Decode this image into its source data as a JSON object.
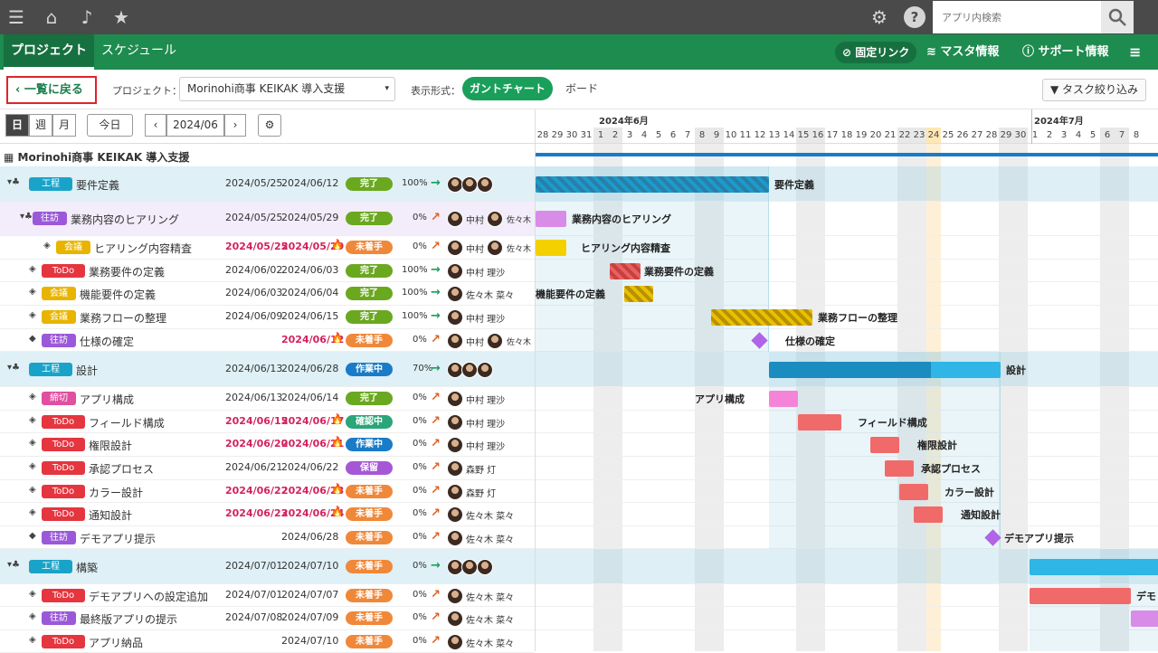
{
  "topbar": {
    "search_placeholder": "アプリ内検索",
    "icons": [
      "menu-icon",
      "home-icon",
      "bell-icon",
      "star-icon",
      "gear-icon",
      "help-icon",
      "search-icon"
    ]
  },
  "nav": {
    "tabs": [
      "プロジェクト",
      "スケジュール"
    ],
    "fixed_link": "固定リンク",
    "master": "マスタ情報",
    "support": "サポート情報"
  },
  "controls": {
    "back": "一覧に戻る",
    "project_label": "プロジェクト：",
    "project_value": "Morinohi商事 KEIKAK 導入支援",
    "view_label": "表示形式：",
    "view_gantt": "ガントチャート",
    "view_board": "ボード",
    "filter": "タスク絞り込み"
  },
  "toolbar": {
    "day": "日",
    "week": "週",
    "month": "月",
    "today": "今日",
    "current_month": "2024/06"
  },
  "project_title": "Morinohi商事 KEIKAK 導入支援",
  "timeline": {
    "months": [
      "2024年6月",
      "2024年7月"
    ],
    "days": [
      "28",
      "29",
      "30",
      "31",
      "1",
      "2",
      "3",
      "4",
      "5",
      "6",
      "7",
      "8",
      "9",
      "10",
      "11",
      "12",
      "13",
      "14",
      "15",
      "16",
      "17",
      "18",
      "19",
      "20",
      "21",
      "22",
      "23",
      "24",
      "25",
      "26",
      "27",
      "28",
      "29",
      "30",
      "1",
      "2",
      "3",
      "4",
      "5",
      "6",
      "7",
      "8"
    ]
  },
  "colors": {
    "green": "#1e8b4f",
    "done": "#6aa820",
    "notstarted": "#f0883a",
    "inprogress": "#1a7bc6",
    "checking": "#2aa67a",
    "hold": "#a657d6",
    "kotei": "#1aa3c8",
    "oufuku": "#9b59d9",
    "kaigi": "#e8b400",
    "todo": "#e5353f",
    "shime": "#e04fa0"
  },
  "rows": [
    {
      "type": "工程",
      "name": "要件定義",
      "start": "2024/05/25",
      "end": "2024/06/12",
      "status": "完了",
      "pct": "100",
      "people": "",
      "group": true
    },
    {
      "type": "往訪",
      "name": "業務内容のヒアリング",
      "start": "2024/05/25",
      "end": "2024/05/29",
      "status": "完了",
      "pct": "0",
      "people": "中村",
      "people2": "佐々木",
      "sub": true
    },
    {
      "type": "会議",
      "name": "ヒアリング内容精査",
      "start": "2024/05/25",
      "end": "2024/05/29",
      "status": "未着手",
      "pct": "0",
      "people": "中村",
      "people2": "佐々木",
      "late": true
    },
    {
      "type": "ToDo",
      "name": "業務要件の定義",
      "start": "2024/06/02",
      "end": "2024/06/03",
      "status": "完了",
      "pct": "100",
      "people": "中村 理沙"
    },
    {
      "type": "会議",
      "name": "機能要件の定義",
      "start": "2024/06/03",
      "end": "2024/06/04",
      "status": "完了",
      "pct": "100",
      "people": "佐々木 菜々"
    },
    {
      "type": "会議",
      "name": "業務フローの整理",
      "start": "2024/06/09",
      "end": "2024/06/15",
      "status": "完了",
      "pct": "100",
      "people": "中村 理沙"
    },
    {
      "type": "往訪",
      "name": "仕様の確定",
      "start": "",
      "end": "2024/06/12",
      "status": "未着手",
      "pct": "0",
      "people": "中村",
      "people2": "佐々木",
      "late": true,
      "milestone": true
    },
    {
      "type": "工程",
      "name": "設計",
      "start": "2024/06/13",
      "end": "2024/06/28",
      "status": "作業中",
      "pct": "70",
      "people": "",
      "group": true
    },
    {
      "type": "締切",
      "name": "アプリ構成",
      "start": "2024/06/13",
      "end": "2024/06/14",
      "status": "完了",
      "pct": "0",
      "people": "中村 理沙"
    },
    {
      "type": "ToDo",
      "name": "フィールド構成",
      "start": "2024/06/15",
      "end": "2024/06/17",
      "status": "確認中",
      "pct": "0",
      "people": "中村 理沙",
      "late": true
    },
    {
      "type": "ToDo",
      "name": "権限設計",
      "start": "2024/06/20",
      "end": "2024/06/21",
      "status": "作業中",
      "pct": "0",
      "people": "中村 理沙",
      "late": true
    },
    {
      "type": "ToDo",
      "name": "承認プロセス",
      "start": "2024/06/21",
      "end": "2024/06/22",
      "status": "保留",
      "pct": "0",
      "people": "森野 灯"
    },
    {
      "type": "ToDo",
      "name": "カラー設計",
      "start": "2024/06/22",
      "end": "2024/06/23",
      "status": "未着手",
      "pct": "0",
      "people": "森野 灯",
      "late": true
    },
    {
      "type": "ToDo",
      "name": "通知設計",
      "start": "2024/06/23",
      "end": "2024/06/24",
      "status": "未着手",
      "pct": "0",
      "people": "佐々木 菜々",
      "late": true
    },
    {
      "type": "往訪",
      "name": "デモアプリ提示",
      "start": "",
      "end": "2024/06/28",
      "status": "未着手",
      "pct": "0",
      "people": "佐々木 菜々",
      "milestone": true
    },
    {
      "type": "工程",
      "name": "構築",
      "start": "2024/07/01",
      "end": "2024/07/10",
      "status": "未着手",
      "pct": "0",
      "people": "",
      "group": true
    },
    {
      "type": "ToDo",
      "name": "デモアプリへの設定追加",
      "start": "2024/07/01",
      "end": "2024/07/07",
      "status": "未着手",
      "pct": "0",
      "people": "佐々木 菜々"
    },
    {
      "type": "往訪",
      "name": "最終版アプリの提示",
      "start": "2024/07/08",
      "end": "2024/07/09",
      "status": "未着手",
      "pct": "0",
      "people": "佐々木 菜々"
    },
    {
      "type": "ToDo",
      "name": "アプリ納品",
      "start": "",
      "end": "2024/07/10",
      "status": "未着手",
      "pct": "0",
      "people": "佐々木 菜々"
    }
  ],
  "chart_labels": [
    "要件定義",
    "業務内容のヒアリング",
    "ヒアリング内容精査",
    "業務要件の定義",
    "機能要件の定義",
    "業務フローの整理",
    "仕様の確定",
    "設計",
    "アプリ構成",
    "フィールド構成",
    "権限設計",
    "承認プロセス",
    "カラー設計",
    "通知設計",
    "デモアプリ提示",
    "",
    "デモ",
    ""
  ],
  "pct_suffix": "%"
}
